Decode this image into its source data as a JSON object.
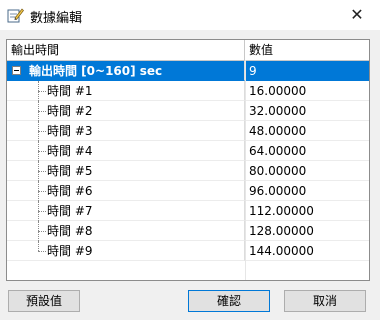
{
  "window": {
    "title": "數據編輯",
    "close_glyph": "✕"
  },
  "table": {
    "columns": [
      "輸出時間",
      "數值"
    ],
    "parent": {
      "label": "輸出時間 [0~160] sec",
      "value": "9"
    },
    "rows": [
      {
        "label": "時間 #1",
        "value": "16.00000"
      },
      {
        "label": "時間 #2",
        "value": "32.00000"
      },
      {
        "label": "時間 #3",
        "value": "48.00000"
      },
      {
        "label": "時間 #4",
        "value": "64.00000"
      },
      {
        "label": "時間 #5",
        "value": "80.00000"
      },
      {
        "label": "時間 #6",
        "value": "96.00000"
      },
      {
        "label": "時間 #7",
        "value": "112.00000"
      },
      {
        "label": "時間 #8",
        "value": "128.00000"
      },
      {
        "label": "時間 #9",
        "value": "144.00000"
      }
    ]
  },
  "buttons": {
    "default_label": "預設值",
    "ok_label": "確認",
    "cancel_label": "取消"
  },
  "colors": {
    "selection": "#0078d7"
  }
}
